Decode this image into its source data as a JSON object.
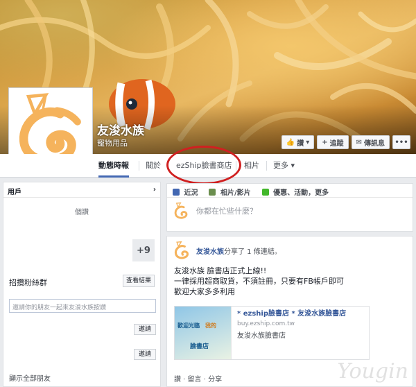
{
  "page": {
    "name": "友浚水族",
    "category": "寵物用品"
  },
  "cover_buttons": {
    "like": "讚",
    "follow": "追蹤",
    "message": "傳訊息",
    "more": "•••"
  },
  "tabs": [
    {
      "label": "動態時報"
    },
    {
      "label": "關於"
    },
    {
      "label": "ezShip臉書商店"
    },
    {
      "label": "相片"
    },
    {
      "label": "更多 ▾"
    }
  ],
  "left": {
    "header": "用戶",
    "header_arrow": "›",
    "likes_label": "個讚",
    "plus_count": "+9",
    "invite_title": "招攬粉絲群",
    "results_button": "查看結果",
    "invite_placeholder": "邀請你的朋友一起來友浚水族按讚",
    "invite_button": "邀請",
    "show_all": "顯示全部朋友"
  },
  "composer": {
    "tabs": [
      "近況",
      "相片/影片",
      "優惠、活動，更多"
    ],
    "placeholder": "你都在忙些什麼？"
  },
  "post": {
    "author": "友浚水族",
    "action": "分享了 1 條連結。",
    "lines": [
      "友浚水族 臉書店正式上線!!",
      "一律採用超商取貨，不須註冊，只要有FB帳戶即可",
      "歡迎大家多多利用"
    ],
    "link_title": "* ezship臉書店 * 友浚水族臉書店",
    "link_url": "buy.ezship.com.tw",
    "link_desc": "友浚水族臉書店",
    "thumb_line1": "歡迎光臨",
    "thumb_line2": "我的",
    "thumb_line3": "臉書店",
    "actions": "讚 · 留言 · 分享"
  },
  "watermark": "Yougin",
  "colors": {
    "brand": "#4267b2",
    "logo_orange": "#f5b35c",
    "highlight_ring": "#d02020"
  }
}
